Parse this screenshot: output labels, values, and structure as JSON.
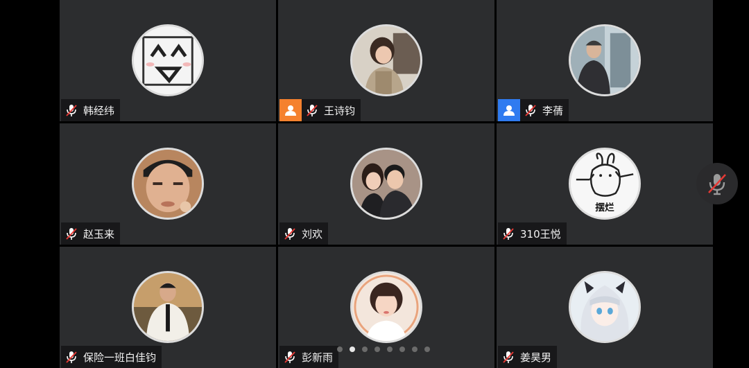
{
  "colors": {
    "tile_bg": "#2c2d2f",
    "host_badge_orange": "#f5812e",
    "host_badge_blue": "#2f7bf0",
    "muted_slash": "#e53935"
  },
  "participants": [
    {
      "name": "韩经纬",
      "role_badge": null,
      "mic": "muted-mic-icon"
    },
    {
      "name": "王诗钧",
      "role_badge": "orange-person-icon",
      "mic": "muted-mic-icon"
    },
    {
      "name": "李蒨",
      "role_badge": "blue-person-icon",
      "mic": "muted-mic-icon"
    },
    {
      "name": "赵玉来",
      "role_badge": null,
      "mic": "muted-mic-icon"
    },
    {
      "name": "刘欢",
      "role_badge": null,
      "mic": "muted-mic-icon"
    },
    {
      "name": "310王悦",
      "role_badge": null,
      "mic": "muted-mic-icon"
    },
    {
      "name": "保险一班白佳钧",
      "role_badge": null,
      "mic": "muted-mic-icon"
    },
    {
      "name": "彭新雨",
      "role_badge": null,
      "mic": "muted-mic-icon"
    },
    {
      "name": "姜昊男",
      "role_badge": null,
      "mic": "muted-mic-icon"
    }
  ],
  "pagination": {
    "pages": 8,
    "current": 2
  },
  "floating_button": {
    "icon": "muted-mic-icon"
  }
}
